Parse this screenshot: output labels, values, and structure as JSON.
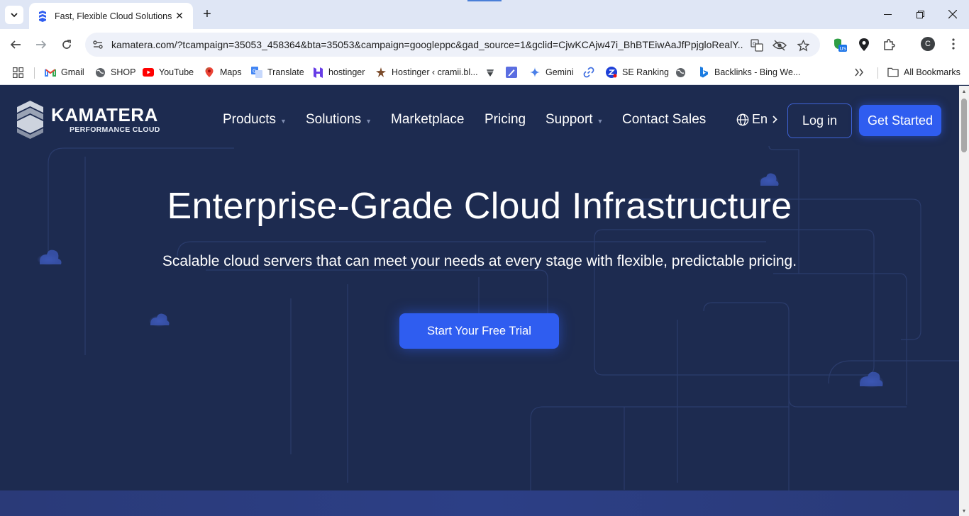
{
  "browser": {
    "tab": {
      "title": "Fast, Flexible Cloud Solutions | Ka"
    },
    "url": "kamatera.com/?tcampaign=35053_458364&bta=35053&campaign=googleppc&gad_source=1&gclid=CjwKCAjw47i_BhBTEiwAaJfPpjglo​RealY...",
    "profile_initial": "C",
    "bookmarks": [
      {
        "label": "Gmail",
        "icon": "gmail-icon"
      },
      {
        "label": "SHOP",
        "icon": "globe-icon"
      },
      {
        "label": "YouTube",
        "icon": "youtube-icon"
      },
      {
        "label": "Maps",
        "icon": "maps-icon"
      },
      {
        "label": "Translate",
        "icon": "translate-icon"
      },
      {
        "label": "hostinger",
        "icon": "hostinger-icon"
      },
      {
        "label": "Hostinger ‹ cramii.bl...",
        "icon": "hostinger-star-icon"
      },
      {
        "label": "",
        "icon": "bookmark-icon"
      },
      {
        "label": "",
        "icon": "pen-icon"
      },
      {
        "label": "Gemini",
        "icon": "gemini-icon"
      },
      {
        "label": "",
        "icon": "link-icon"
      },
      {
        "label": "SE Ranking",
        "icon": "seranking-icon"
      },
      {
        "label": "",
        "icon": "globe-icon"
      },
      {
        "label": "Backlinks - Bing We...",
        "icon": "bing-icon"
      }
    ],
    "all_bookmarks": "All Bookmarks"
  },
  "site": {
    "logo": {
      "main": "KAMATERA",
      "sub": "PERFORMANCE CLOUD"
    },
    "nav": {
      "products": "Products",
      "solutions": "Solutions",
      "marketplace": "Marketplace",
      "pricing": "Pricing",
      "support": "Support",
      "contact": "Contact Sales"
    },
    "lang": "En",
    "login": "Log in",
    "get_started": "Get Started",
    "hero": {
      "title": "Enterprise-Grade Cloud Infrastructure",
      "subtitle": "Scalable cloud servers that can meet your needs at every stage with flexible, predictable pricing.",
      "cta": "Start Your Free Trial"
    }
  },
  "colors": {
    "page_bg": "#1d2b50",
    "accent": "#2f5df0",
    "tab_strip": "#dfe6f5"
  }
}
